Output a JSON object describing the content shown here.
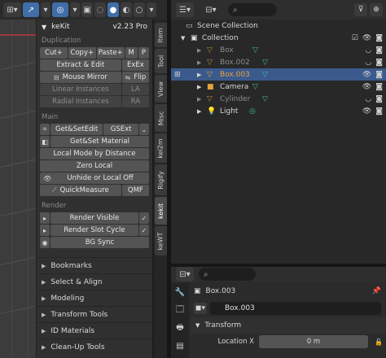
{
  "viewport_header": {
    "icons": [
      "cursor-icon",
      "magnet-icon",
      "overlay-icon",
      "xray-icon",
      "wireframe-icon",
      "solid-icon",
      "material-icon",
      "rendered-icon"
    ]
  },
  "npanel": {
    "title": "keKit",
    "version": "v2.23 Pro",
    "duplication": {
      "label": "Duplication",
      "cut": "Cut+",
      "copy": "Copy+",
      "paste": "Paste+",
      "m": "M",
      "p": "P",
      "extract": "Extract & Edit",
      "exex": "ExEx",
      "mouse_mirror": "Mouse Mirror",
      "flip": "Flip",
      "linear": "Linear Instances",
      "la": "LA",
      "radial": "Radial Instances",
      "ra": "RA"
    },
    "main": {
      "label": "Main",
      "getset_edit": "Get&SetEdit",
      "gsext": "GSExt",
      "getset_material": "Get&Set Material",
      "local_mode": "Local Mode by Distance",
      "zero_local": "Zero Local",
      "unhide": "Unhide or Local Off",
      "quickmeasure": "QuickMeasure",
      "qmf": "QMF"
    },
    "render": {
      "label": "Render",
      "render_visible": "Render Visible",
      "render_slot": "Render Slot Cycle",
      "bg_sync": "BG Sync"
    },
    "sections": [
      "Bookmarks",
      "Select & Align",
      "Modeling",
      "Transform Tools",
      "ID Materials",
      "Clean-Up Tools"
    ]
  },
  "tabs": [
    "Item",
    "Tool",
    "View",
    "Misc",
    "kei2m",
    "Rigify",
    "kekit",
    "keWT"
  ],
  "outliner": {
    "scene_collection": "Scene Collection",
    "collection": "Collection",
    "items": [
      {
        "name": "Box",
        "dim": true,
        "selected": false
      },
      {
        "name": "Box.002",
        "dim": true,
        "selected": false
      },
      {
        "name": "Box.003",
        "dim": false,
        "selected": true
      },
      {
        "name": "Camera",
        "dim": false,
        "selected": false
      },
      {
        "name": "Cylinder",
        "dim": true,
        "selected": false
      },
      {
        "name": "Light",
        "dim": false,
        "selected": false
      }
    ]
  },
  "properties": {
    "object_name": "Box.003",
    "data_name": "Box.003",
    "transform_label": "Transform",
    "location_x_label": "Location X",
    "location_x_value": "0 m"
  },
  "colors": {
    "accent_blue": "#3f6ea8",
    "selected_row": "#3b5a8c",
    "object_orange": "#e8a23d",
    "mesh_teal": "#3fb8a4"
  }
}
